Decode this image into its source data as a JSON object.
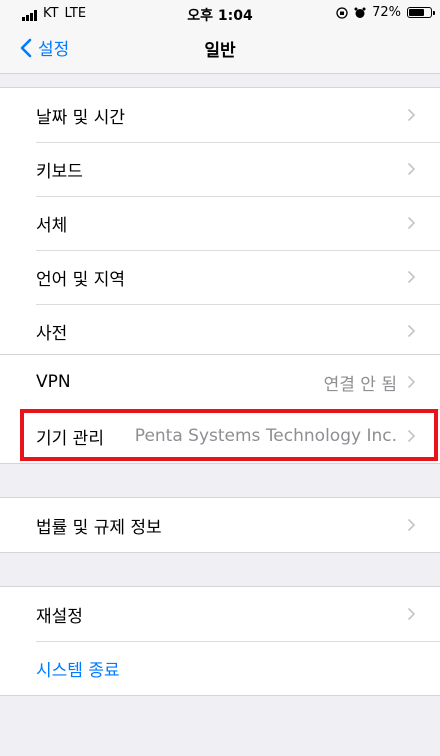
{
  "status_bar": {
    "carrier": "KT",
    "network": "LTE",
    "time": "오후 1:04",
    "battery": "72%",
    "battery_level": 0.72
  },
  "nav": {
    "back_label": "설정",
    "title": "일반"
  },
  "groups": [
    {
      "rows": [
        {
          "label": "날짜 및 시간",
          "value": "",
          "chevron": true
        },
        {
          "label": "키보드",
          "value": "",
          "chevron": true
        },
        {
          "label": "서체",
          "value": "",
          "chevron": true
        },
        {
          "label": "언어 및 지역",
          "value": "",
          "chevron": true
        },
        {
          "label": "사전",
          "value": "",
          "chevron": true
        }
      ]
    },
    {
      "rows": [
        {
          "label": "VPN",
          "value": "연결 안 됨",
          "chevron": true
        },
        {
          "label": "기기 관리",
          "value": "Penta Systems Technology Inc.",
          "chevron": true
        }
      ]
    },
    {
      "rows": [
        {
          "label": "법률 및 규제 정보",
          "value": "",
          "chevron": true
        }
      ]
    },
    {
      "rows": [
        {
          "label": "재설정",
          "value": "",
          "chevron": true
        },
        {
          "label": "시스템 종료",
          "value": "",
          "chevron": false
        }
      ]
    }
  ],
  "colors": {
    "accent": "#007aff",
    "highlight": "#e8131b",
    "secondary_text": "#8e8e93",
    "background": "#efeff4"
  }
}
